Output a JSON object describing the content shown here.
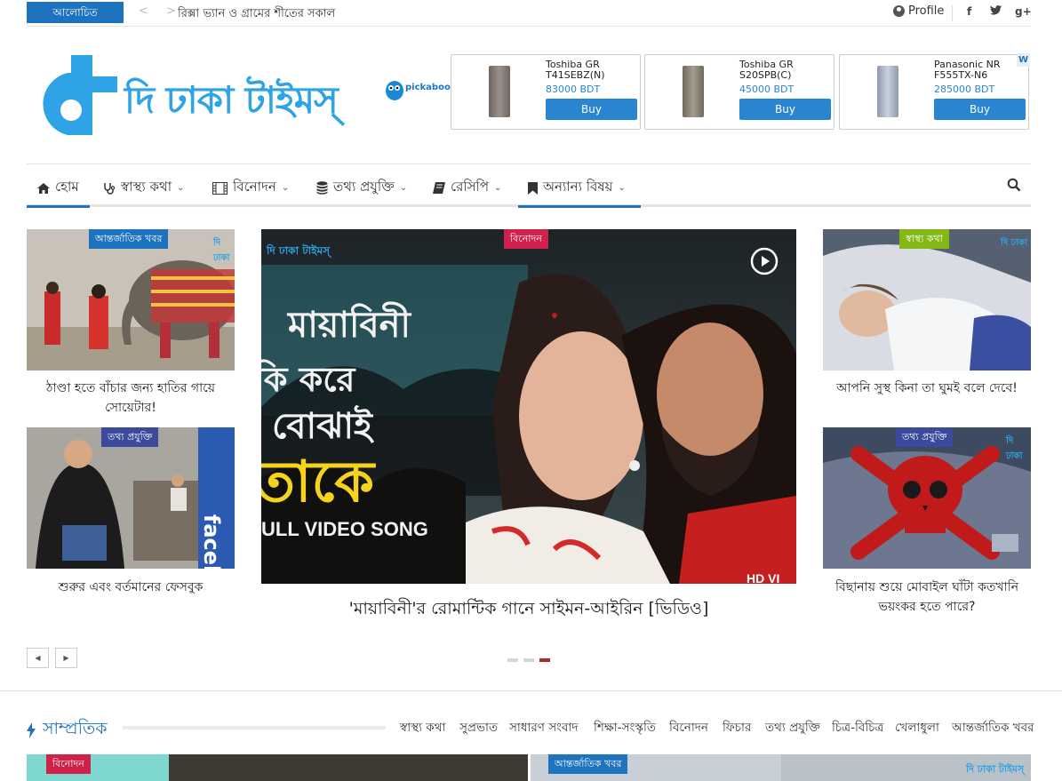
{
  "topbar": {
    "trending_label": "আলোচিত",
    "nav_arrows": "< >",
    "ticker": "রিক্সা ভ্যান ও গ্রামের শীতের সকাল",
    "profile_label": "Profile",
    "social": [
      "f",
      "y",
      "g+"
    ]
  },
  "header": {
    "logo_text": "দি ঢাকা টাইমস্",
    "pickaboo_label": "pickaboo",
    "ads": [
      {
        "name": "Toshiba GR T41SEBZ(N)",
        "price": "83000 BDT",
        "buy": "Buy",
        "color": "#8a7f78"
      },
      {
        "name": "Toshiba GR S20SPB(C)",
        "price": "45000 BDT",
        "buy": "Buy",
        "color": "#8a8378"
      },
      {
        "name": "Panasonic NR F555TX-N6",
        "price": "285000 BDT",
        "buy": "Buy",
        "color": "#a9b4c2"
      }
    ],
    "ad_badge": "W"
  },
  "nav": {
    "items": [
      {
        "label": "হোম",
        "icon": "home-icon"
      },
      {
        "label": "স্বাস্থ্য কথা",
        "icon": "stethoscope-icon"
      },
      {
        "label": "বিনোদন",
        "icon": "film-icon"
      },
      {
        "label": "তথ্য প্রযুক্তি",
        "icon": "database-icon"
      },
      {
        "label": "রেসিপি",
        "icon": "book-icon"
      },
      {
        "label": "অন্যান্য বিষয়",
        "icon": "bookmark-icon"
      }
    ],
    "search_icon": "search-icon"
  },
  "featured": {
    "left": [
      {
        "category": "আন্তর্জাতিক খবর",
        "caption": "ঠাণ্ডা হতে বাঁচার জন্য হাতির গায়ে সোয়েটার!"
      },
      {
        "category": "তথ্য প্রযুক্তি",
        "caption": "শুরুর এবং বর্তমানের ফেসবুক"
      }
    ],
    "center": {
      "category": "বিনোদন",
      "caption": "'মায়াবিনী'র রোমান্টিক গানে সাইমন-আইরিন [ভিডিও]",
      "overlay_title": "মায়াবিনী",
      "overlay_line2": "কি করে",
      "overlay_line3": "বোঝাই",
      "overlay_line4": "তাকে",
      "overlay_line5": "ULL VIDEO SONG",
      "overlay_logo": "দি ঢাকা টাইমস্",
      "overlay_hd": "HD VI"
    },
    "right": [
      {
        "category": "স্বাস্থ্য কথা",
        "caption": "আপনি সুস্থ কিনা তা ঘুমই বলে দেবে!"
      },
      {
        "category": "তথ্য প্রযুক্তি",
        "caption": "বিছানায় শুয়ে মোবাইল ঘাঁটা কতখানি ভয়ংকর হতে পারে?"
      }
    ],
    "facebook_text": "facebook",
    "watermark": "দি ঢাকা"
  },
  "latest": {
    "title": "সাম্প্রতিক",
    "filters": [
      "স্বাস্থ্য কথা",
      "সুপ্রভাত",
      "সাধারণ সংবাদ",
      "শিক্ষা-সংস্কৃতি",
      "বিনোদন",
      "ফিচার",
      "তথ্য প্রযুক্তি",
      "চিত্র-বিচিত্র",
      "খেলাধুলা",
      "আন্তর্জাতিক খবর"
    ],
    "posts": [
      {
        "category": "বিনোদন"
      },
      {
        "category": "আন্তর্জাতিক খবর"
      }
    ],
    "logo_text": "দি ঢাকা টাইমস্"
  },
  "colors": {
    "brand_blue": "#1e73be",
    "cat_intl": "#1e73be",
    "cat_entertain": "#d0214a",
    "cat_health": "#84b816",
    "cat_tech": "#3b4a9c"
  }
}
